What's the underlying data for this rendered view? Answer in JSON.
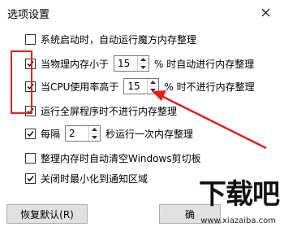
{
  "window": {
    "title": "选项设置",
    "close_icon": "close-icon"
  },
  "options": {
    "auto_start": {
      "label": "系统启动时，自动运行魔方内存整理",
      "checked": false
    },
    "mem_low": {
      "label_pre": "当物理内存小于",
      "value": "15",
      "label_post": "% 时自动进行内存整理",
      "checked": true
    },
    "cpu_high": {
      "label_pre": "当CPU使用率高于",
      "value": "15",
      "label_post": "% 时不进行内存整理",
      "checked": true
    },
    "fullscreen": {
      "label": "运行全屏程序时不进行内存整理",
      "checked": true
    },
    "interval": {
      "label_pre": "每隔",
      "value": "2",
      "label_post": "秒运行一次内存整理",
      "checked": true
    },
    "clear_clipboard": {
      "label": "整理内存时自动清空Windows剪切板",
      "checked": false
    },
    "minimize_tray": {
      "label": "关闭时最小化到通知区域",
      "checked": true
    }
  },
  "buttons": {
    "restore_default": "恢复默认(R)",
    "ok_partial": "确"
  },
  "watermark": {
    "brand": "下载吧",
    "url": "www.xiazaiba.com"
  },
  "colors": {
    "annotation_red": "#e02020"
  }
}
